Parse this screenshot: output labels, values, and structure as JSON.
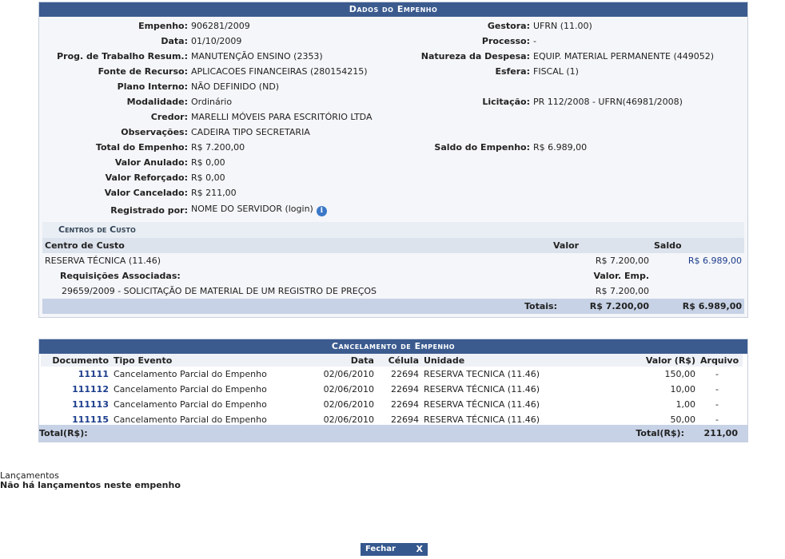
{
  "empenho": {
    "title": "Dados do Empenho",
    "left": [
      {
        "label": "Empenho:",
        "value": "906281/2009"
      },
      {
        "label": "Data:",
        "value": "01/10/2009"
      },
      {
        "label": "Prog. de Trabalho Resum.:",
        "value": "MANUTENÇÃO ENSINO (2353)"
      },
      {
        "label": "Fonte de Recurso:",
        "value": "APLICACOES FINANCEIRAS (280154215)"
      },
      {
        "label": "Plano Interno:",
        "value": "NÃO DEFINIDO (ND)"
      },
      {
        "label": "Modalidade:",
        "value": "Ordinário"
      },
      {
        "label": "Credor:",
        "value": "MARELLI MÓVEIS PARA ESCRITÓRIO LTDA"
      },
      {
        "label": "Observações:",
        "value": "CADEIRA TIPO SECRETARIA"
      },
      {
        "label": "Total do Empenho:",
        "value": "R$ 7.200,00"
      },
      {
        "label": "Valor Anulado:",
        "value": "R$ 0,00"
      },
      {
        "label": "Valor Reforçado:",
        "value": "R$ 0,00"
      },
      {
        "label": "Valor Cancelado:",
        "value": "R$ 211,00"
      },
      {
        "label": "Registrado por:",
        "value": "NOME DO SERVIDOR (login)"
      }
    ],
    "right": {
      "gestora": {
        "label": "Gestora:",
        "value": "UFRN (11.00)"
      },
      "processo": {
        "label": "Processo:",
        "value": "-"
      },
      "natureza": {
        "label": "Natureza da Despesa:",
        "value": "EQUIP. MATERIAL PERMANENTE (449052)"
      },
      "esfera": {
        "label": "Esfera:",
        "value": "FISCAL (1)"
      },
      "licitacao": {
        "label": "Licitação:",
        "value": "PR 112/2008 - UFRN(46981/2008)"
      },
      "saldo": {
        "label": "Saldo do Empenho:",
        "value": "R$ 6.989,00"
      }
    },
    "info_icon": "info-icon",
    "centros": {
      "title": "Centros de Custo",
      "headers": {
        "centro": "Centro de Custo",
        "valor": "Valor",
        "saldo": "Saldo"
      },
      "row": {
        "centro": "RESERVA TÉCNICA (11.46)",
        "valor": "R$ 7.200,00",
        "saldo": "R$ 6.989,00"
      },
      "req_label": "Requisições Associadas:",
      "req_valor_label": "Valor. Emp.",
      "req_item": "29659/2009 - SOLICITAÇÃO DE MATERIAL DE UM REGISTRO DE PREÇOS",
      "req_item_valor": "R$ 7.200,00",
      "totais_label": "Totais:",
      "totais_valor": "R$ 7.200,00",
      "totais_saldo": "R$ 6.989,00"
    }
  },
  "cancelamento": {
    "title": "Cancelamento de Empenho",
    "headers": {
      "documento": "Documento",
      "tipo": "Tipo Evento",
      "data": "Data",
      "celula": "Célula",
      "unidade": "Unidade",
      "valor": "Valor (R$)",
      "arquivo": "Arquivo"
    },
    "rows": [
      {
        "documento": "11111",
        "tipo": "Cancelamento Parcial do Empenho",
        "data": "02/06/2010",
        "celula": "22694",
        "unidade": "RESERVA TECNICA (11.46)",
        "valor": "150,00",
        "arquivo": "-"
      },
      {
        "documento": "111112",
        "tipo": "Cancelamento Parcial do Empenho",
        "data": "02/06/2010",
        "celula": "22694",
        "unidade": "RESERVA TÉCNICA (11.46)",
        "valor": "10,00",
        "arquivo": "-"
      },
      {
        "documento": "111113",
        "tipo": "Cancelamento Parcial do Empenho",
        "data": "02/06/2010",
        "celula": "22694",
        "unidade": "RESERVA TÉCNICA (11.46)",
        "valor": "1,00",
        "arquivo": "-"
      },
      {
        "documento": "111115",
        "tipo": "Cancelamento Parcial do Empenho",
        "data": "02/06/2010",
        "celula": "22694",
        "unidade": "RESERVA TÉCNICA (11.46)",
        "valor": "50,00",
        "arquivo": "-"
      }
    ],
    "footer_left": "Total(R$):",
    "footer_right_label": "Total(R$):",
    "footer_total": "211,00"
  },
  "lancamentos": {
    "title": "Lançamentos",
    "message": "Não há lançamentos neste empenho"
  },
  "fechar": {
    "label": "Fechar",
    "icon_glyph": "X",
    "icon": "close-icon"
  }
}
